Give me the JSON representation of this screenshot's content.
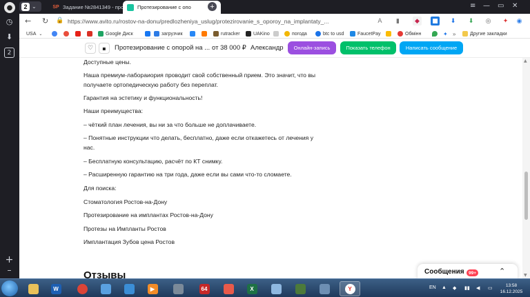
{
  "browser": {
    "sidebar": {
      "profile_badge": "2"
    },
    "tab_counter": "2",
    "tabs": [
      {
        "title": "Задание №2841349 - про",
        "favicon": "SP",
        "active": false
      },
      {
        "title": "Протезирование с опо",
        "active": true
      }
    ],
    "new_tab": "+",
    "url": {
      "host": "https://www.avito.ru",
      "path": "/rostov-na-donu/predlozheniya_uslug/protezirovanie_s_oporoy_na_implantaty_..."
    }
  },
  "bookmarks": [
    {
      "label": "USA",
      "color": "#3a6fd8"
    },
    {
      "label": "Google Диск",
      "color": "#1fa463"
    },
    {
      "label": "загрузчик",
      "color": "#2d7be5"
    },
    {
      "label": "rutracker",
      "color": "#7a5c2e"
    },
    {
      "label": "UAKino",
      "color": "#222222"
    },
    {
      "label": "погода",
      "color": "#f2b705"
    },
    {
      "label": "btc to usd",
      "color": "#1a73e8"
    },
    {
      "label": "FaucetPay",
      "color": "#1e88e5"
    },
    {
      "label": "Обмінн",
      "color": "#e53935"
    },
    {
      "label": "Другие закладки",
      "color": "#f2c94c"
    }
  ],
  "listing_bar": {
    "title": "Протезирование с опорой на ...",
    "price": "от 38 000 ₽",
    "seller": "Александр",
    "online_button": "Онлайн-запись",
    "phone_button": "Показать телефон",
    "message_button": "Написать сообщение",
    "colors": {
      "online": "#9b4fe0",
      "phone": "#00c06a",
      "message": "#00a6f4"
    }
  },
  "description": [
    "Доступные цены.",
    "Наша премиум-лабораиория проводит свой собственный прием. Это значит, что вы получаете ортопедическую работу без переплат.",
    "Гарантия на эстетику и функциональность!",
    "Наши преимущества:",
    "– чёткий план лечения, вы ни за что больше не доплачиваете.",
    "– Понятные инструкции что делать, бесплатно, даже если откажетесь от лечения у нас.",
    "– Бесплатную консультацию, расчёт по КТ снимку.",
    "– Расширенную гарантию на три года, даже если вы сами что-то сломаете.",
    "Для поиска:",
    "Стоматология Ростов-на-Дону",
    "Протезирование на имплантах Ростов-на-Дону",
    "Протезы на Импланты Ростов",
    "Имплантация Зубов цена Ростов"
  ],
  "reviews_heading": "Отзывы",
  "messages_widget": {
    "label": "Сообщения",
    "badge": "99+"
  },
  "taskbar": {
    "language": "EN",
    "time": "13:58",
    "date": "16.12.2025",
    "pinned_label_64": "64"
  }
}
